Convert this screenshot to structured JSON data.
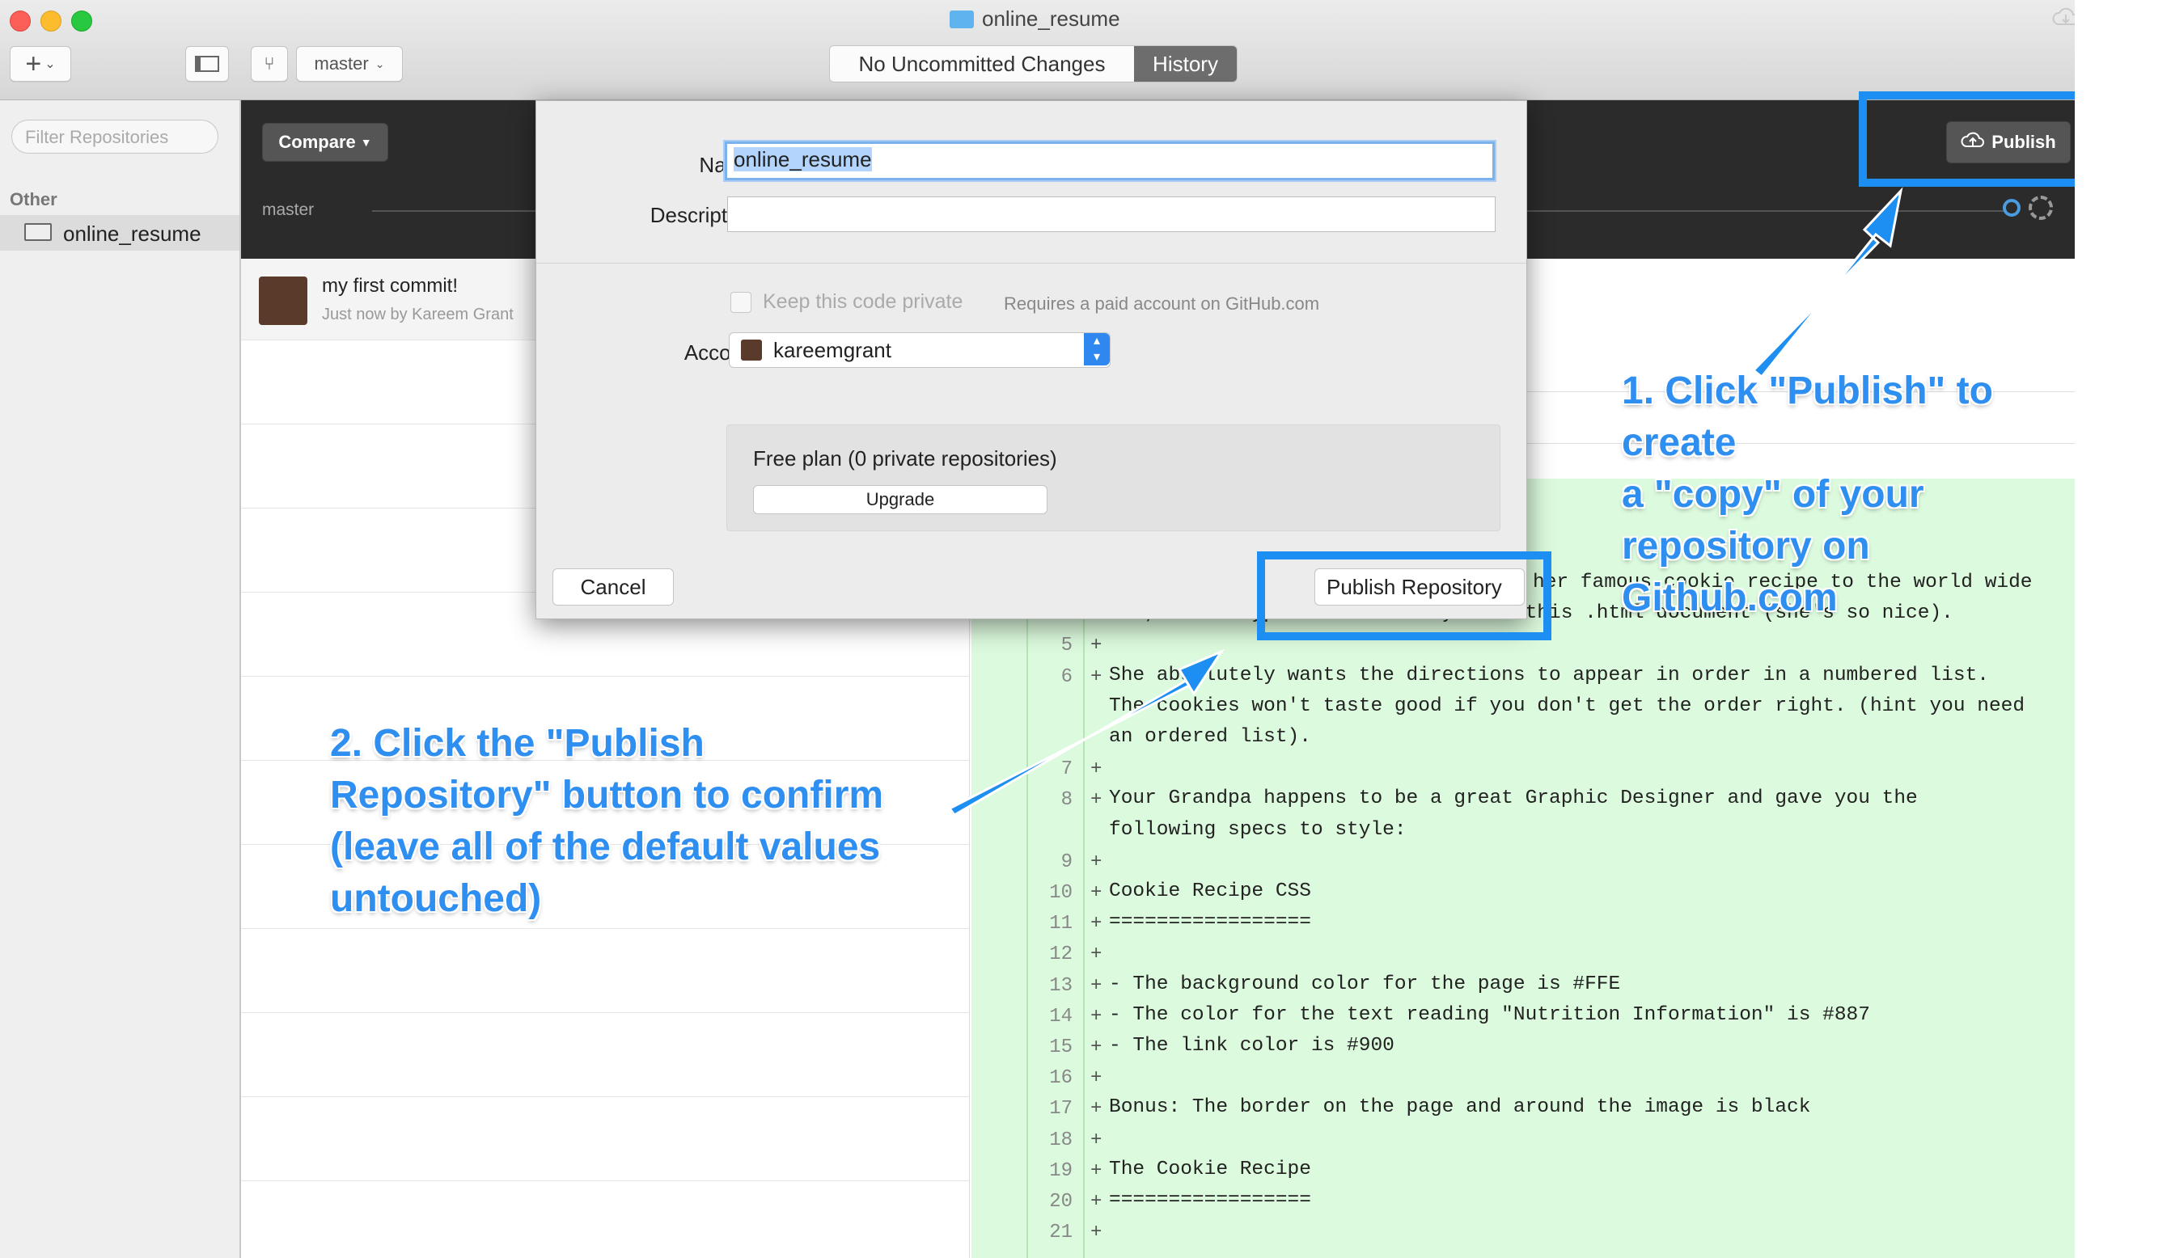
{
  "window": {
    "title": "online_resume",
    "branch_button": "master",
    "segments": [
      "No Uncommitted Changes",
      "History"
    ],
    "active_segment": "History"
  },
  "sidebar": {
    "filter_placeholder": "Filter Repositories",
    "section": "Other",
    "repo": "online_resume"
  },
  "main": {
    "compare_label": "Compare",
    "branch_label": "master",
    "publish_label": "Publish",
    "commit": {
      "title": "my first commit!",
      "meta": "Just now by Kareem Grant"
    }
  },
  "modal": {
    "name_label": "Name:",
    "name_value": "online_resume",
    "description_label": "Description:",
    "description_value": "",
    "private_label": "Keep this code private",
    "private_note": "Requires a paid account on GitHub.com",
    "account_label": "Account:",
    "account_value": "kareemgrant",
    "plan_text": "Free plan (0 private repositories)",
    "upgrade_label": "Upgrade",
    "cancel_label": "Cancel",
    "publish_repo_label": "Publish Repository"
  },
  "diff": {
    "lines": [
      {
        "num": "",
        "text": "her famous cookie recipe to the world wide"
      },
      {
        "num": "",
        "text": "web, she's typed it out for you in this .html document (she's so nice)."
      },
      {
        "num": "5",
        "text": ""
      },
      {
        "num": "6",
        "text": "She absolutely wants the directions to appear in order in a numbered list."
      },
      {
        "num": "",
        "text": "The cookies won't taste good if you don't get the order right. (hint you need"
      },
      {
        "num": "",
        "text": "an ordered list)."
      },
      {
        "num": "7",
        "text": ""
      },
      {
        "num": "8",
        "text": "Your Grandpa happens to be a great Graphic Designer and gave you the"
      },
      {
        "num": "",
        "text": "following specs to style:"
      },
      {
        "num": "9",
        "text": ""
      },
      {
        "num": "10",
        "text": "Cookie Recipe CSS"
      },
      {
        "num": "11",
        "text": "================="
      },
      {
        "num": "12",
        "text": ""
      },
      {
        "num": "13",
        "text": "- The background color for the page is #FFE"
      },
      {
        "num": "14",
        "text": "- The color for the text reading \"Nutrition Information\" is #887"
      },
      {
        "num": "15",
        "text": "- The link color is #900"
      },
      {
        "num": "16",
        "text": ""
      },
      {
        "num": "17",
        "text": "Bonus: The border on the page and around the image is black"
      },
      {
        "num": "18",
        "text": ""
      },
      {
        "num": "19",
        "text": "The Cookie Recipe"
      },
      {
        "num": "20",
        "text": "================="
      },
      {
        "num": "21",
        "text": ""
      }
    ]
  },
  "annotations": {
    "step1": [
      "1. Click \"Publish\" to create",
      "a \"copy\" of your",
      "repository on Github.com"
    ],
    "step2": [
      "2. Click the \"Publish",
      "Repository\" button to confirm",
      "(leave all of the default values",
      "untouched)"
    ],
    "color": "#1d8ef2"
  }
}
